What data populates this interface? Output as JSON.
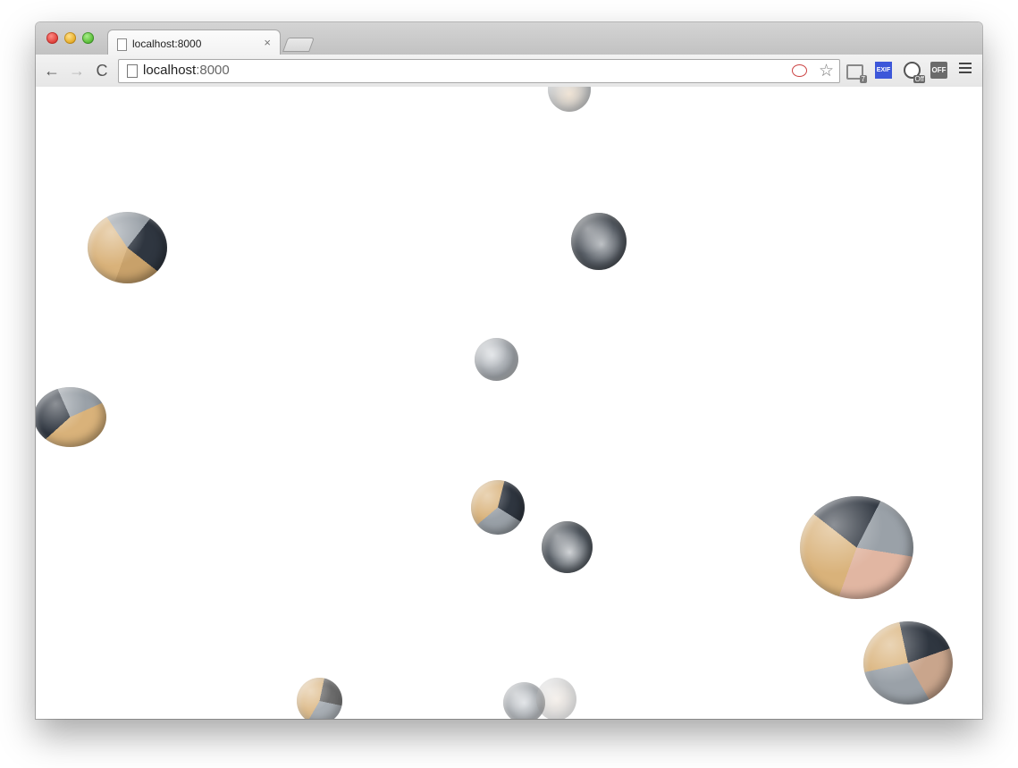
{
  "browser": {
    "tab": {
      "title": "localhost:8000",
      "close_glyph": "×"
    },
    "toolbar": {
      "back_glyph": "←",
      "forward_glyph": "→",
      "reload_glyph": "C",
      "url_host": "localhost",
      "url_port": ":8000",
      "star_glyph": "☆",
      "extensions": {
        "gmail_badge": "7",
        "exif_label": "EXIF",
        "globe_badge": "Off",
        "off_label": "OFF"
      }
    }
  },
  "icons": [
    "page-icon",
    "back-arrow-icon",
    "forward-arrow-icon",
    "reload-icon",
    "bookmark-star-icon",
    "gmail-extension-icon",
    "exif-extension-icon",
    "globe-extension-icon",
    "off-extension-icon",
    "menu-icon"
  ],
  "colors": {
    "exif_bg": "#3d57d9",
    "sphere_wood": "#d9b27a",
    "sphere_dark": "#2f3640",
    "sphere_laptop": "#9aa1a8"
  }
}
